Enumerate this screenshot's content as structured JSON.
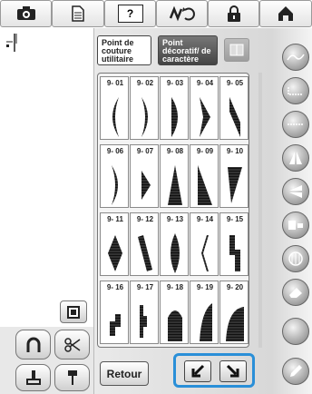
{
  "toolbar": {
    "buttons": [
      {
        "name": "camera-button",
        "icon": "camera-icon"
      },
      {
        "name": "document-button",
        "icon": "document-icon"
      },
      {
        "name": "help-button",
        "icon": "help-icon",
        "label": "?"
      },
      {
        "name": "feed-dogs-button",
        "icon": "feed-dogs-icon"
      },
      {
        "name": "lock-button",
        "icon": "lock-icon"
      },
      {
        "name": "home-button",
        "icon": "home-icon"
      }
    ]
  },
  "categories": {
    "utility_label": "Point de couture utilitaire",
    "decorative_label": "Point décoratif/ de caractère"
  },
  "stitches": [
    {
      "code": "9- 01",
      "shape": "crescent-left"
    },
    {
      "code": "9- 02",
      "shape": "crescent-right"
    },
    {
      "code": "9- 03",
      "shape": "half-oval"
    },
    {
      "code": "9- 04",
      "shape": "chevron-right"
    },
    {
      "code": "9- 05",
      "shape": "bar-slant"
    },
    {
      "code": "9- 06",
      "shape": "crescent-right"
    },
    {
      "code": "9- 07",
      "shape": "triangle-right"
    },
    {
      "code": "9- 08",
      "shape": "triangle-up"
    },
    {
      "code": "9- 09",
      "shape": "right-triangle"
    },
    {
      "code": "9- 10",
      "shape": "wedge"
    },
    {
      "code": "9- 11",
      "shape": "diamond"
    },
    {
      "code": "9- 12",
      "shape": "parallelogram"
    },
    {
      "code": "9- 13",
      "shape": "leaf"
    },
    {
      "code": "9- 14",
      "shape": "zigzag-diamond"
    },
    {
      "code": "9- 15",
      "shape": "steps"
    },
    {
      "code": "9- 16",
      "shape": "steps-small"
    },
    {
      "code": "9- 17",
      "shape": "bracket"
    },
    {
      "code": "9- 18",
      "shape": "dome"
    },
    {
      "code": "9- 19",
      "shape": "curve-wedge"
    },
    {
      "code": "9- 20",
      "shape": "hill"
    }
  ],
  "actions": {
    "back_label": "Retour"
  },
  "colors": {
    "highlight": "#2a8fd8"
  }
}
